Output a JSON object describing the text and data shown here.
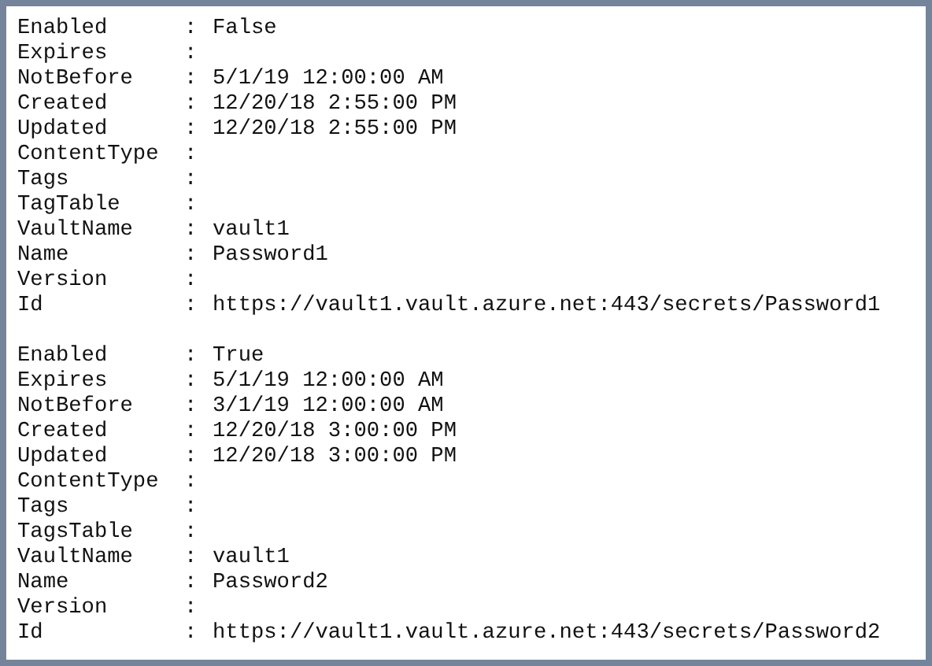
{
  "blocks": [
    {
      "rows": [
        {
          "name": "Enabled",
          "separator": ":",
          "value": "False"
        },
        {
          "name": "Expires",
          "separator": ":"
        },
        {
          "name": "NotBefore",
          "separator": ":",
          "value": "5/1/19 12:00:00 AM"
        },
        {
          "name": "Created",
          "separator": ":",
          "value": "12/20/18 2:55:00 PM"
        },
        {
          "name": "Updated",
          "separator": ":",
          "value": "12/20/18 2:55:00 PM"
        },
        {
          "name": "ContentType",
          "separator": ":"
        },
        {
          "name": "Tags",
          "separator": ":"
        },
        {
          "name": "TagTable",
          "separator": ":"
        },
        {
          "name": "VaultName",
          "separator": ":",
          "value": "vault1"
        },
        {
          "name": "Name",
          "separator": ":",
          "value": "Password1"
        },
        {
          "name": "Version",
          "separator": ":"
        },
        {
          "name": "Id",
          "separator": ":",
          "value": "https://vault1.vault.azure.net:443/secrets/Password1"
        }
      ]
    },
    {
      "rows": [
        {
          "name": "Enabled",
          "separator": ":",
          "value": "True"
        },
        {
          "name": "Expires",
          "separator": ":",
          "value": "5/1/19 12:00:00 AM"
        },
        {
          "name": "NotBefore",
          "separator": ":",
          "value": "3/1/19 12:00:00 AM"
        },
        {
          "name": "Created",
          "separator": ":",
          "value": "12/20/18 3:00:00 PM"
        },
        {
          "name": "Updated",
          "separator": ":",
          "value": "12/20/18 3:00:00 PM"
        },
        {
          "name": "ContentType",
          "separator": ":"
        },
        {
          "name": "Tags",
          "separator": ":"
        },
        {
          "name": "TagsTable",
          "separator": ":"
        },
        {
          "name": "VaultName",
          "separator": ":",
          "value": "vault1"
        },
        {
          "name": "Name",
          "separator": ":",
          "value": "Password2"
        },
        {
          "name": "Version",
          "separator": ":"
        },
        {
          "name": "Id",
          "separator": ":",
          "value": "https://vault1.vault.azure.net:443/secrets/Password2"
        }
      ]
    }
  ]
}
